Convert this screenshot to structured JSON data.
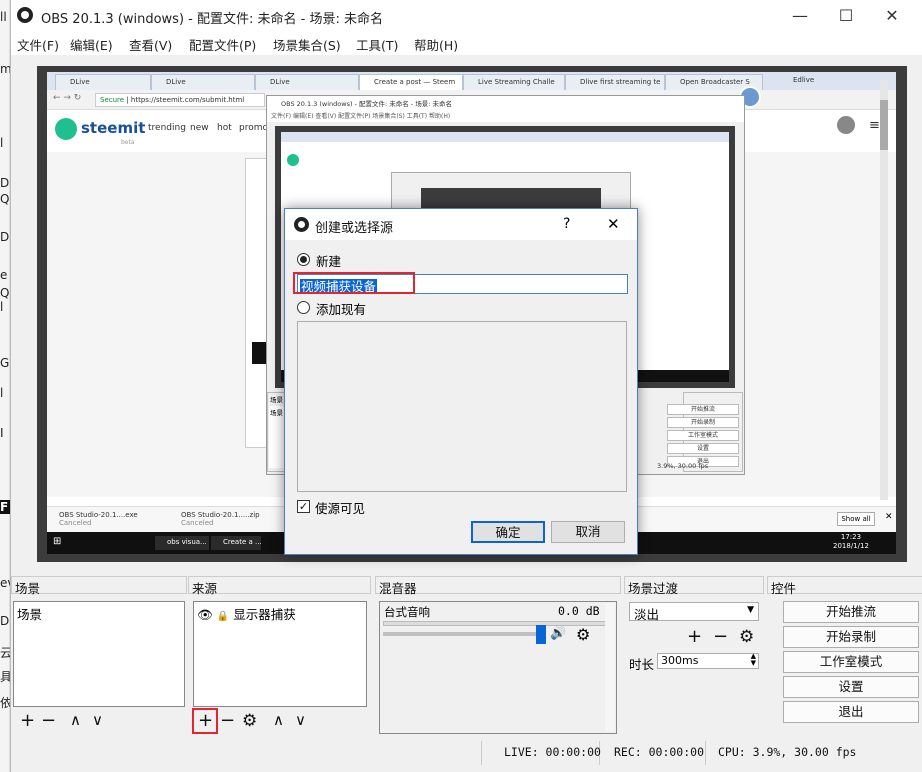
{
  "window": {
    "title": "OBS 20.1.3 (windows) - 配置文件: 未命名 - 场景: 未命名",
    "minimize": "—",
    "maximize": "☐",
    "close": "✕"
  },
  "menu": [
    "文件(F)",
    "编辑(E)",
    "查看(V)",
    "配置文件(P)",
    "场景集合(S)",
    "工具(T)",
    "帮助(H)"
  ],
  "capture": {
    "tabs": [
      "DLive",
      "DLive",
      "DLive",
      "Create a post — Steem",
      "Live Streaming Challe",
      "Dlive first streaming te",
      "Open Broadcaster S"
    ],
    "user_tab": "Edlive",
    "secure": "Secure",
    "url": "https://steemit.com/submit.html",
    "steemit_logo": "steemit",
    "steemit_beta": "beta",
    "nav": [
      "trending",
      "new",
      "hot",
      "promo"
    ],
    "downloads": [
      "OBS Studio-20.1....exe",
      "OBS Studio-20.1.....zip"
    ],
    "download_status": "Canceled",
    "show_all": "Show all",
    "taskbar_items": [
      "obs visua...",
      "Create a ..."
    ],
    "clock_time": "17:23",
    "clock_date": "2018/1/12",
    "nested_title": "OBS 20.1.3 (windows) - 配置文件: 未命名 - 场景: 未命名",
    "nested_menu": "文件(F)   编辑(E)   查看(V)   配置文件(P)   场景集合(S)   工具(T)   帮助(H)",
    "nested_buttons": [
      "开始推流",
      "开始录制",
      "工作室模式",
      "设置",
      "退出"
    ],
    "nested_scene_header": "场景",
    "nested_scene_item": "场景",
    "nested_status": "3.9%, 30.00 fps",
    "left_edge_chars": [
      "ll",
      "m",
      "l",
      "D",
      "Q",
      "D",
      "e",
      "l",
      "Q",
      "G",
      "F",
      "I",
      "l",
      "ev",
      "D",
      "云",
      "具",
      "依"
    ]
  },
  "panels": {
    "scenes_header": "场景",
    "sources_header": "来源",
    "mixer_header": "混音器",
    "transitions_header": "场景过渡",
    "controls_header": "控件",
    "scene_item": "场景",
    "source_item": "显示器捕获",
    "mixer_track": "台式音响",
    "mixer_db": "0.0 dB",
    "transition_select": "淡出",
    "duration_label": "时长",
    "duration_value": "300ms",
    "buttons": [
      "开始推流",
      "开始录制",
      "工作室模式",
      "设置",
      "退出"
    ]
  },
  "status": {
    "live": "LIVE: 00:00:00",
    "rec": "REC: 00:00:00",
    "cpu": "CPU: 3.9%, 30.00 fps"
  },
  "dialog": {
    "title": "创建或选择源",
    "help": "?",
    "close": "✕",
    "new_label": "新建",
    "name_value": "视频捕获设备",
    "existing_label": "添加现有",
    "visible_label": "使源可见",
    "ok": "确定",
    "cancel": "取消"
  },
  "colors": {
    "highlight": "#e0262f",
    "selection": "#0a64d6",
    "steemit": "#1a5099"
  }
}
